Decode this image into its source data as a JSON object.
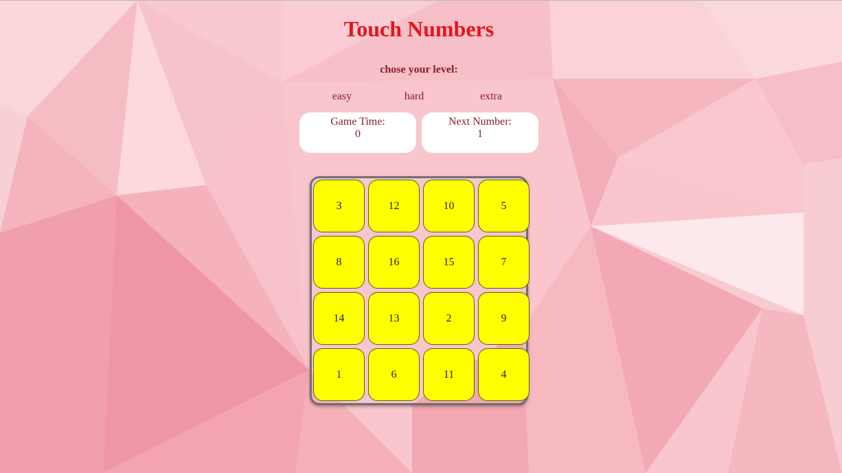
{
  "header": {
    "title": "Touch Numbers"
  },
  "level": {
    "prompt": "chose your level:",
    "options": [
      "easy",
      "hard",
      "extra"
    ]
  },
  "game_time": {
    "label": "Game Time:",
    "value": "0"
  },
  "next_number": {
    "label": "Next Number:",
    "value": "1"
  },
  "board": {
    "rows": [
      [
        "3",
        "12",
        "10",
        "5"
      ],
      [
        "8",
        "16",
        "15",
        "7"
      ],
      [
        "14",
        "13",
        "2",
        "9"
      ],
      [
        "1",
        "6",
        "11",
        "4"
      ]
    ]
  },
  "colors": {
    "title": "#e8131c",
    "text": "#8b1d2a",
    "cell": "#ffff00",
    "background": "#f9c3ca"
  }
}
